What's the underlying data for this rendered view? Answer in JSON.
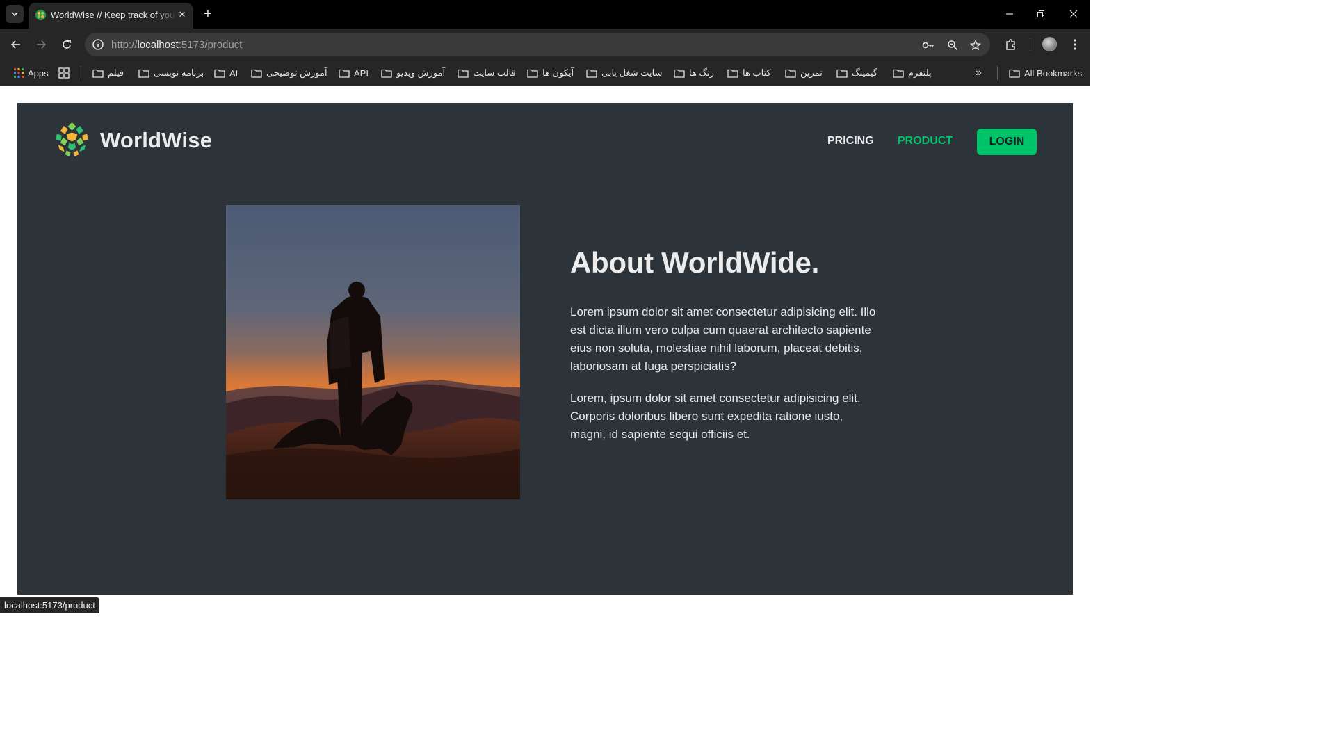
{
  "browser": {
    "tab": {
      "title": "WorldWise // Keep track of your adventures",
      "close": "✕"
    },
    "new_tab": "+",
    "window_controls": {
      "minimize": "─",
      "restore": "❐",
      "close": "✕"
    },
    "address": {
      "scheme": "http://",
      "host": "localhost",
      "rest": ":5173/product"
    },
    "bookmarks": {
      "apps": "Apps",
      "items": [
        "فیلم",
        "برنامه نویسی",
        "AI",
        "آموزش توضیحی",
        "API",
        "آموزش ویدیو",
        "قالب سایت",
        "آیکون ها",
        "سایت شغل یابی",
        "رنگ ها",
        "کتاب ها",
        "تمرین",
        "گیمینگ",
        "پلتفرم"
      ],
      "overflow": "»",
      "all_bookmarks": "All Bookmarks"
    },
    "status_url": "localhost:5173/product"
  },
  "page": {
    "brand": "WorldWise",
    "nav": {
      "pricing": "PRICING",
      "product": "PRODUCT",
      "login": "LOGIN"
    },
    "headline": "About WorldWide.",
    "paragraph1": "Lorem ipsum dolor sit amet consectetur adipisicing elit. Illo est dicta illum vero culpa cum quaerat architecto sapiente eius non soluta, molestiae nihil laborum, placeat debitis, laboriosam at fuga perspiciatis?",
    "paragraph2": "Lorem, ipsum dolor sit amet consectetur adipisicing elit. Corporis doloribus libero sunt expedita ratione iusto, magni, id sapiente sequi officiis et."
  },
  "colors": {
    "app_bg": "#2d3439",
    "accent": "#00c46a",
    "text": "#ececec",
    "chrome_dark": "#262626"
  }
}
